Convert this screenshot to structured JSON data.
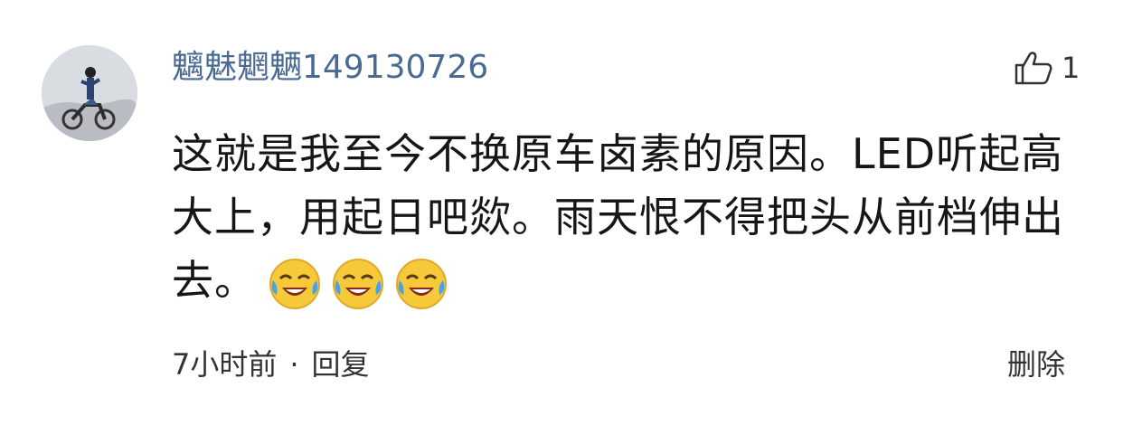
{
  "comment": {
    "username": "魑魅魍魉149130726",
    "like_icon": "thumbs-up-icon",
    "like_count": "1",
    "text": "这就是我至今不换原车卤素的原因。LED听起高大上，用起日吧欻。雨天恨不得把头从前档伸出去。",
    "emojis": [
      "laughing-crying-emoji",
      "laughing-crying-emoji",
      "laughing-crying-emoji"
    ],
    "time": "7小时前",
    "separator": "·",
    "reply_label": "回复",
    "delete_label": "删除"
  },
  "colors": {
    "username": "#4a6a93",
    "text": "#161616",
    "meta": "#333333",
    "emoji_face": "#f6c93a"
  }
}
